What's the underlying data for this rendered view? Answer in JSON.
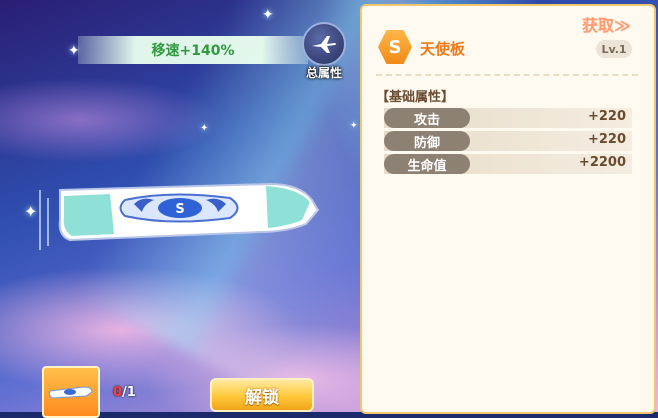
{
  "left": {
    "speed_bonus": "移速+140%",
    "total_attr_label": "总属性",
    "owned_count": "0",
    "required_count": "/1",
    "unlock_label": "解锁"
  },
  "item": {
    "rarity": "S",
    "name": "天使板",
    "obtain_label": "获取≫",
    "level": "Lv.1"
  },
  "base_attributes": {
    "title": "【基础属性】",
    "stats": [
      {
        "name": "攻击",
        "value": "+220"
      },
      {
        "name": "防御",
        "value": "+220"
      },
      {
        "name": "生命值",
        "value": "+2200"
      }
    ]
  },
  "colors": {
    "speed_text": "#2f9a3f",
    "item_name": "#f07a1a",
    "obtain_link": "#ff9a70",
    "panel_border": "#f2c66a",
    "unlock_button": "#ffc83a"
  },
  "icons": {
    "total_attr": "airplane-icon",
    "thumbnail": "hoverboard-icon"
  }
}
